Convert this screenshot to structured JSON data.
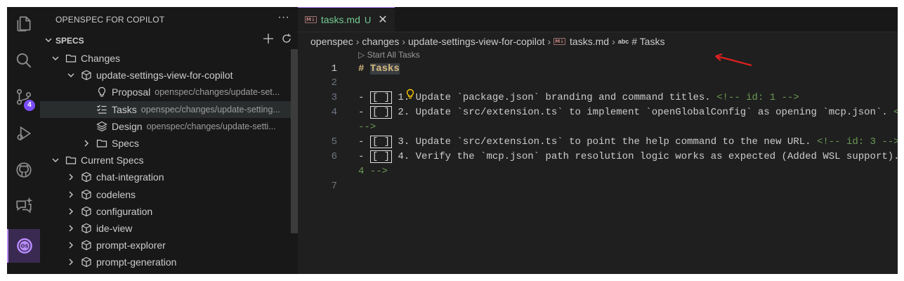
{
  "activity_bar": {
    "items": [
      "explorer-icon",
      "search-icon",
      "source-control-icon",
      "run-debug-icon",
      "github-icon",
      "chat-icon",
      "openspec-icon"
    ],
    "scm_badge": "4"
  },
  "sidebar": {
    "title": "OPENSPEC FOR COPILOT",
    "more": "···",
    "section": "SPECS",
    "tree": [
      {
        "label": "Changes"
      },
      {
        "label": "update-settings-view-for-copilot"
      },
      {
        "label": "Proposal",
        "desc": "openspec/changes/update-set..."
      },
      {
        "label": "Tasks",
        "desc": "openspec/changes/update-setting..."
      },
      {
        "label": "Design",
        "desc": "openspec/changes/update-setti..."
      },
      {
        "label": "Specs"
      },
      {
        "label": "Current Specs"
      },
      {
        "label": "chat-integration"
      },
      {
        "label": "codelens"
      },
      {
        "label": "configuration"
      },
      {
        "label": "ide-view"
      },
      {
        "label": "prompt-explorer"
      },
      {
        "label": "prompt-generation"
      }
    ]
  },
  "editor": {
    "tab": {
      "icon_text": "M↓",
      "filename": "tasks.md",
      "status": "U",
      "close": "✕"
    },
    "breadcrumb": [
      "openspec",
      "changes",
      "update-settings-view-for-copilot",
      "tasks.md",
      "# Tasks"
    ],
    "breadcrumb_symbol": "abc",
    "codelens": "▷ Start All Tasks",
    "line_numbers": [
      "1",
      "2",
      "3",
      "4",
      "",
      "5",
      "6",
      "",
      "7"
    ],
    "lines": {
      "l1_hash": "#",
      "l1_text": "Tasks",
      "l3_pre": "- ",
      "l3_box": "[ ]",
      "l3_text": " 1. Update `package.json` branding and command titles. ",
      "l3_cmt": "<!-- id: 1 -->",
      "l4_pre": "- ",
      "l4_box": "[ ]",
      "l4_text": " 2. Update `src/extension.ts` to implement `openGlobalConfig` as opening `mcp.json`. ",
      "l4_cmt": "<!--",
      "l4_wrap": "-->",
      "l5_pre": "- ",
      "l5_box": "[ ]",
      "l5_text": " 3. Update `src/extension.ts` to point the help command to the new URL. ",
      "l5_cmt": "<!-- id: 3 -->",
      "l6_pre": "- ",
      "l6_box": "[ ]",
      "l6_text": " 4. Verify the `mcp.json` path resolution logic works as expected (Added WSL support). ",
      "l6_wrap": "4 -->"
    }
  }
}
